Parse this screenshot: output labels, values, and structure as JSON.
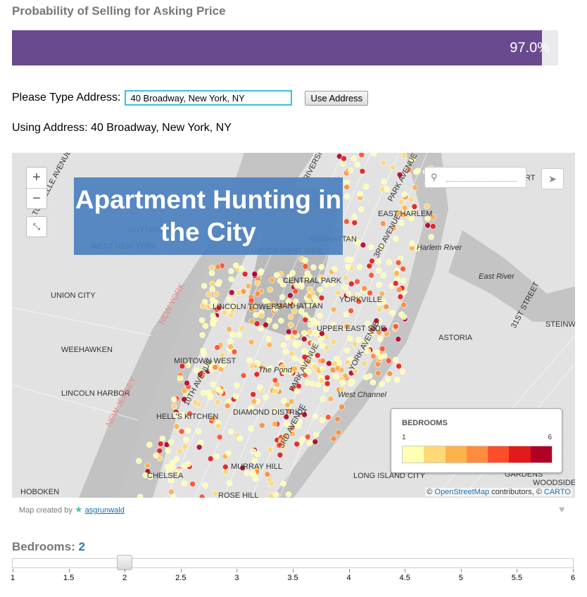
{
  "header": {
    "title": "Probability of Selling for Asking Price"
  },
  "probability": {
    "label": "97.0%",
    "value": 0.97,
    "color": "#6a4a8f"
  },
  "address": {
    "prompt": "Please Type Address:",
    "input_value": "40 Broadway, New York, NY",
    "button_label": "Use Address",
    "using_text": "Using Address: 40 Broadway, New York, NY"
  },
  "map": {
    "overlay_title": "Apartment Hunting in the City",
    "zoom_in": "+",
    "zoom_out": "−",
    "labels": [
      "WEST NEW YORK",
      "UNION CITY",
      "WEEHAWKEN",
      "LINCOLN HARBOR",
      "HOBOKEN",
      "GUTTENBERG",
      "UPPER WEST SIDE",
      "CENTRAL PARK",
      "LINCOLN TOWERS",
      "MANHATTAN",
      "MIDTOWN WEST",
      "HELL'S KITCHEN",
      "CHELSEA",
      "DIAMOND DISTRICT",
      "MURRAY HILL",
      "ROSE HILL",
      "YORKVILLE",
      "UPPER EAST SIDE",
      "EAST HARLEM",
      "MANHATTAN",
      "ASTORIA",
      "LONG ISLAND CITY",
      "GARDENS",
      "WOODSIDE",
      "STEINWAY",
      "Harlem River",
      "East River",
      "West Channel",
      "The Pond",
      "NEW YORK",
      "NEW JERSEY",
      "TONNELLE AVENUE",
      "10TH AVENUE",
      "PARK AVENUE",
      "3RD AVENUE",
      "YORK AVENUE",
      "31ST STREET",
      "RIVERSIDE DR",
      "3RD AVENUE",
      "PARK AVENUE",
      "RT"
    ],
    "attribution_prefix": "© ",
    "attribution_osm": "OpenStreetMap",
    "attribution_mid": " contributors, © ",
    "attribution_carto": "CARTO",
    "icons": [
      "search-icon",
      "locate-arrow-icon",
      "fullscreen-icon"
    ]
  },
  "legend": {
    "title": "BEDROOMS",
    "min": "1",
    "max": "6",
    "colors": [
      "#ffffb2",
      "#fed976",
      "#feb24c",
      "#fd8d3c",
      "#fc4e2a",
      "#e31a1c",
      "#b10026"
    ]
  },
  "credit": {
    "prefix": "Map created by",
    "user": "asgrunwald"
  },
  "bedrooms": {
    "label": "Bedrooms:",
    "value": "2",
    "min": 1,
    "max": 6,
    "current": 2,
    "ticks": [
      "1",
      "1.5",
      "2",
      "2.5",
      "3",
      "3.5",
      "4",
      "4.5",
      "5",
      "5.5",
      "6"
    ]
  }
}
